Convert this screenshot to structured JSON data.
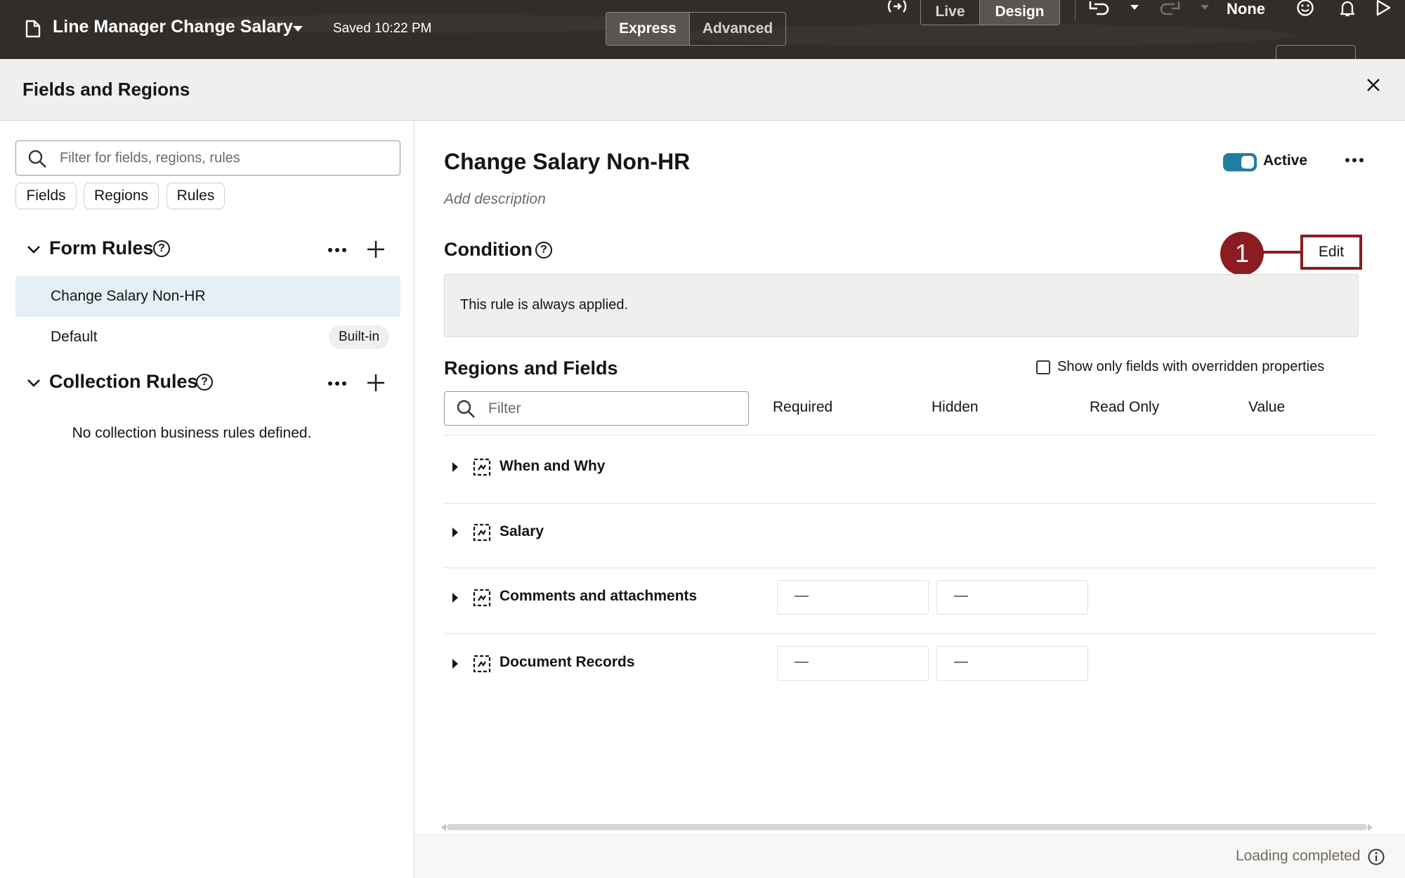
{
  "header": {
    "app_title": "Line Manager Change Salary",
    "saved_status": "Saved 10:22 PM",
    "mode_tabs": [
      "Express",
      "Advanced"
    ],
    "active_mode": "Express",
    "view_tabs": [
      "Live",
      "Design"
    ],
    "active_view": "Design",
    "sandbox_label": "None",
    "icons": [
      "document-icon",
      "caret-down-icon",
      "expression-icon",
      "undo-icon",
      "redo-icon",
      "smiley-icon",
      "bell-icon",
      "play-icon"
    ]
  },
  "panel": {
    "title": "Fields and Regions",
    "close_icon": "close-icon"
  },
  "left": {
    "search_placeholder": "Filter for fields, regions, rules",
    "chips": [
      "Fields",
      "Regions",
      "Rules"
    ],
    "form_rules": {
      "title": "Form Rules",
      "items": [
        {
          "label": "Change Salary Non-HR",
          "selected": true
        },
        {
          "label": "Default",
          "badge": "Built-in"
        }
      ]
    },
    "collection_rules": {
      "title": "Collection Rules",
      "empty_text": "No collection business rules defined."
    }
  },
  "rule": {
    "name": "Change Salary Non-HR",
    "description_placeholder": "Add description",
    "active_label": "Active",
    "active": true,
    "condition_title": "Condition",
    "condition_text": "This rule is always applied.",
    "edit_label": "Edit",
    "callout_number": "1",
    "callout_color": "#8b1c22"
  },
  "regions": {
    "title": "Regions and Fields",
    "show_overridden_label": "Show only fields with overridden properties",
    "show_overridden_checked": false,
    "filter_placeholder": "Filter",
    "columns": [
      "Required",
      "Hidden",
      "Read Only",
      "Value"
    ],
    "rows": [
      {
        "label": "When and Why",
        "required": "",
        "hidden": ""
      },
      {
        "label": "Salary",
        "required": "",
        "hidden": ""
      },
      {
        "label": "Comments and attachments",
        "required": "—",
        "hidden": "—"
      },
      {
        "label": "Document Records",
        "required": "—",
        "hidden": "—"
      }
    ]
  },
  "status": {
    "text": "Loading completed"
  },
  "colors": {
    "topbar_bg": "#312d2a",
    "accent_toggle": "#227e9e",
    "selected_row_bg": "#e4eff6",
    "callout": "#8b1c22"
  }
}
